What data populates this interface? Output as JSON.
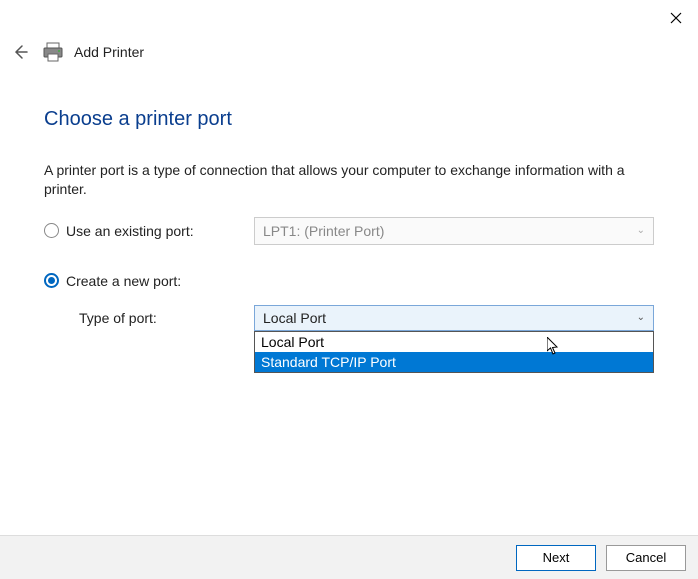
{
  "window": {
    "title": "Add Printer"
  },
  "page": {
    "heading": "Choose a printer port",
    "description": "A printer port is a type of connection that allows your computer to exchange information with a printer."
  },
  "options": {
    "use_existing_label": "Use an existing port:",
    "existing_port_value": "LPT1: (Printer Port)",
    "create_new_label": "Create a new port:",
    "type_of_port_label": "Type of port:",
    "selected_port_type": "Local Port",
    "port_types": [
      "Local Port",
      "Standard TCP/IP Port"
    ]
  },
  "buttons": {
    "next": "Next",
    "cancel": "Cancel"
  }
}
